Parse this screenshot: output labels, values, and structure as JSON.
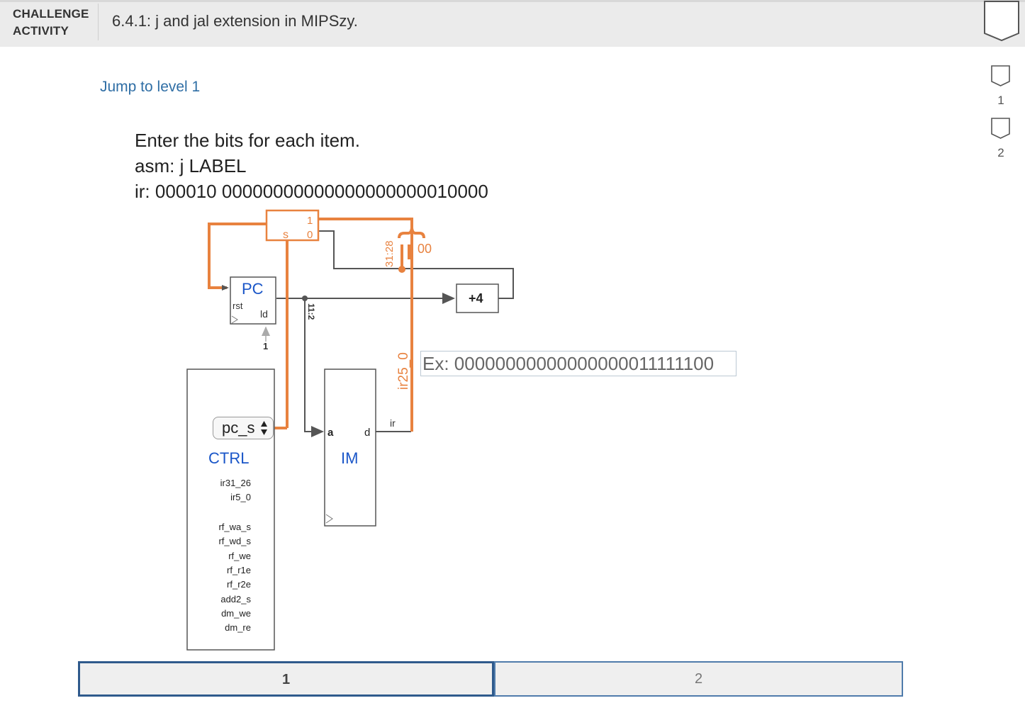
{
  "header": {
    "label_line1": "CHALLENGE",
    "label_line2": "ACTIVITY",
    "title": "6.4.1: j and jal extension in MIPSzy."
  },
  "jump_link": "Jump to level 1",
  "prompt": {
    "instruction": "Enter the bits for each item.",
    "asm": "asm: j LABEL",
    "ir": "ir: 000010 00000000000000000000010000"
  },
  "diagram": {
    "mux_s": "s",
    "mux_in1": "1",
    "mux_in0": "0",
    "bits_31_28": "31:28",
    "zeros": "00",
    "pc_label": "PC",
    "pc_rst": "rst",
    "pc_ld": "ld",
    "ld_value": "1",
    "plus4": "+4",
    "bits_11_2": "11:2",
    "ir25_0": "ir25_0",
    "ir_out": "ir",
    "im_a": "a",
    "im_d": "d",
    "im_label": "IM",
    "ctrl_label": "CTRL",
    "ctrl_inputs": [
      "ir31_26",
      "ir5_0"
    ],
    "ctrl_outputs": [
      "rf_wa_s",
      "rf_wd_s",
      "rf_we",
      "rf_r1e",
      "rf_r2e",
      "add2_s",
      "dm_we",
      "dm_re"
    ]
  },
  "answer_input": {
    "placeholder": "Ex: 00000000000000000011111100",
    "value": ""
  },
  "select": {
    "selected": "pc_s",
    "arrows": "▲▼"
  },
  "levels": {
    "level1": "1",
    "level2": "2",
    "active": 1
  },
  "side_flags": [
    "1",
    "2"
  ],
  "colors": {
    "accent_orange": "#e8823f",
    "link_blue": "#2f6ea5",
    "diagram_blue": "#1a56c8",
    "level_border": "#2f5a8c"
  }
}
